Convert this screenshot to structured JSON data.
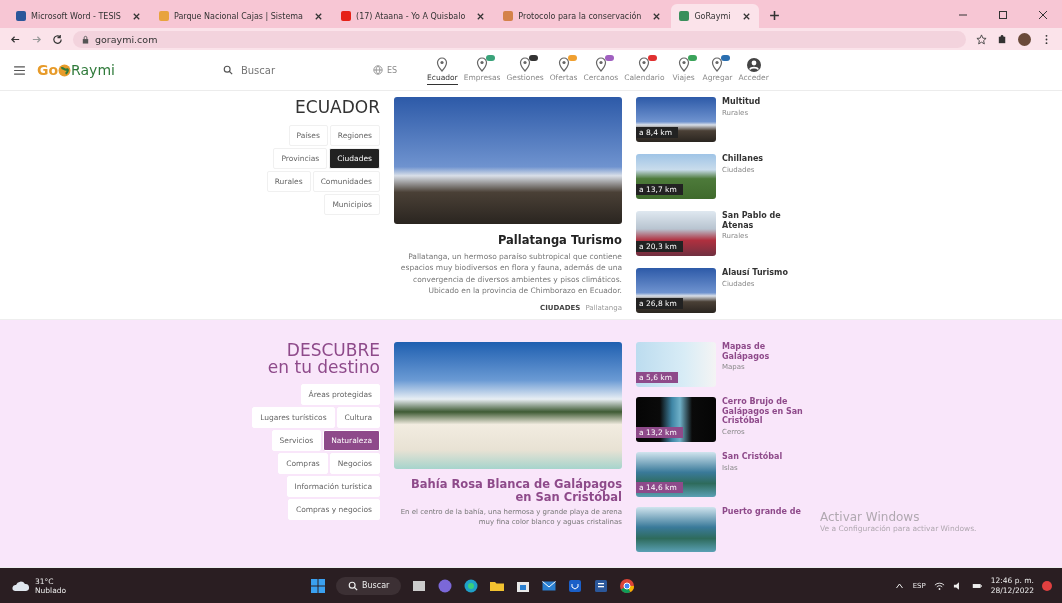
{
  "browser": {
    "tabs": [
      {
        "title": "Microsoft Word - TESIS",
        "selected": false,
        "color": "#2b579a"
      },
      {
        "title": "Parque Nacional Cajas | Sistema",
        "selected": false,
        "color": "#e8a33d"
      },
      {
        "title": "(17) Ataana - Yo A Quisbalo",
        "selected": false,
        "color": "#e62117"
      },
      {
        "title": "Protocolo para la conservación",
        "selected": false,
        "color": "#d4824a"
      },
      {
        "title": "GoRaymi",
        "selected": true,
        "color": "#3a8f5c"
      }
    ],
    "address": "goraymi.com"
  },
  "site_header": {
    "logo_go": "Go",
    "logo_raymi": "Raymi",
    "search": {
      "placeholder": "Buscar"
    },
    "language": "ES",
    "nav": [
      {
        "kind": "pin",
        "label": "Ecuador",
        "selected": true
      },
      {
        "kind": "pin",
        "label": "Empresas",
        "selected": false,
        "color": "#3aa37a"
      },
      {
        "kind": "pin",
        "label": "Gestiones",
        "selected": false,
        "color": "#333333"
      },
      {
        "kind": "pin",
        "label": "Ofertas",
        "selected": false,
        "color": "#f0a030"
      },
      {
        "kind": "pin",
        "label": "Cercanos",
        "selected": false,
        "color": "#a060c0"
      },
      {
        "kind": "pin",
        "label": "Calendario",
        "selected": false,
        "color": "#e03030"
      },
      {
        "kind": "pin",
        "label": "Viajes",
        "selected": false,
        "color": "#3aa35a"
      },
      {
        "kind": "pin",
        "label": "Agregar",
        "selected": false,
        "color": "#2a6fb0"
      },
      {
        "kind": "account",
        "label": "Acceder",
        "selected": false
      }
    ]
  },
  "sections": [
    {
      "kind": "plain",
      "title": "ECUADOR",
      "filters": [
        {
          "label": "Países",
          "selected": false
        },
        {
          "label": "Regiones",
          "selected": false
        },
        {
          "label": "Provincias",
          "selected": false
        },
        {
          "label": "Ciudades",
          "selected": true
        },
        {
          "label": "Rurales",
          "selected": false
        },
        {
          "label": "Comunidades",
          "selected": false
        },
        {
          "label": "Municipios",
          "selected": false
        }
      ],
      "feature": {
        "title": "Pallatanga Turismo",
        "description": "Pallatanga, un hermoso paraíso subtropical que contiene espacios muy biodiversos en flora y fauna, además de una convergencia de diversos ambientes y pisos climáticos. Ubicado en la provincia de Chimborazo en Ecuador.",
        "category": "CIUDADES",
        "place": "Pallatanga"
      },
      "places": [
        {
          "name": "Multitud",
          "category": "Rurales",
          "distance": "a 8,4 km"
        },
        {
          "name": "Chillanes",
          "category": "Ciudades",
          "distance": "a 13,7 km"
        },
        {
          "name": "San Pablo de Atenas",
          "category": "Rurales",
          "distance": "a 20,3 km"
        },
        {
          "name": "Alausí Turismo",
          "category": "Ciudades",
          "distance": "a 26,8 km"
        }
      ]
    },
    {
      "kind": "tinted",
      "title": "DESCUBRE",
      "subtitle": "en tu destino",
      "filters": [
        {
          "label": "Áreas protegidas",
          "selected": false
        },
        {
          "label": "Lugares turísticos",
          "selected": false
        },
        {
          "label": "Cultura",
          "selected": false
        },
        {
          "label": "Servicios",
          "selected": false
        },
        {
          "label": "Naturaleza",
          "selected": true
        },
        {
          "label": "Compras",
          "selected": false
        },
        {
          "label": "Negocios",
          "selected": false
        },
        {
          "label": "Información turística",
          "selected": false
        },
        {
          "label": "Compras y negocios",
          "selected": false
        }
      ],
      "feature": {
        "title": "Bahía Rosa Blanca de Galápagos en San Cristóbal",
        "description": "En el centro de la bahía, una hermosa y grande playa de arena muy fina color blanco y aguas cristalinas"
      },
      "places": [
        {
          "name": "Mapas de Galápagos",
          "category": "Mapas",
          "distance": "a 5,6 km"
        },
        {
          "name": "Cerro Brujo de Galápagos en San Cristóbal",
          "category": "Cerros",
          "distance": "a 13,2 km"
        },
        {
          "name": "San Cristóbal",
          "category": "Islas",
          "distance": "a 14,6 km"
        },
        {
          "name": "Puerto grande de"
        }
      ]
    }
  ],
  "windows_notice": {
    "title": "Activar Windows",
    "text": "Ve a Configuración para activar Windows."
  },
  "taskbar": {
    "temperature": "31°C",
    "weather": "Nublado",
    "search": "Buscar",
    "language": "ESP",
    "time": "12:46 p. m.",
    "date": "28/12/2022"
  }
}
